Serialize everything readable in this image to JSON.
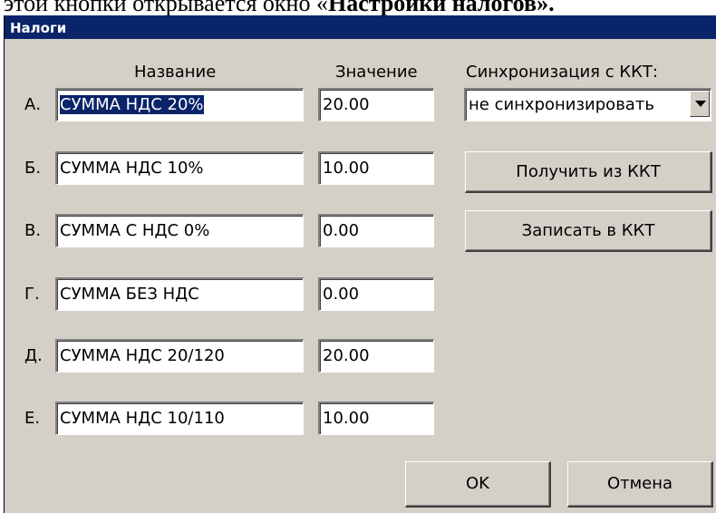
{
  "document": {
    "caption_plain": "этой кнопки открывается окно «",
    "caption_bold": "Настройки налогов",
    "caption_end": "»."
  },
  "window": {
    "title": "Налоги"
  },
  "headers": {
    "name": "Название",
    "value": "Значение",
    "sync": "Синхронизация с ККТ:"
  },
  "taxes": [
    {
      "letter": "А.",
      "name": "СУММА НДС 20%",
      "value": "20.00",
      "selected": true
    },
    {
      "letter": "Б.",
      "name": "СУММА НДС 10%",
      "value": "10.00"
    },
    {
      "letter": "В.",
      "name": "СУММА С НДС 0%",
      "value": "0.00"
    },
    {
      "letter": "Г.",
      "name": "СУММА БЕЗ НДС",
      "value": "0.00"
    },
    {
      "letter": "Д.",
      "name": "СУММА НДС 20/120",
      "value": "20.00"
    },
    {
      "letter": "Е.",
      "name": "СУММА НДС 10/110",
      "value": "10.00"
    }
  ],
  "sync": {
    "selected": "не синхронизировать",
    "icon": "chevron-down-icon"
  },
  "buttons": {
    "get_from_kkt": "Получить из ККТ",
    "write_to_kkt": "Записать в ККТ",
    "ok": "OK",
    "cancel": "Отмена"
  },
  "colors": {
    "titlebar": "#0a246a",
    "dialog_bg": "#d4d0c8",
    "selection": "#0a246a"
  }
}
